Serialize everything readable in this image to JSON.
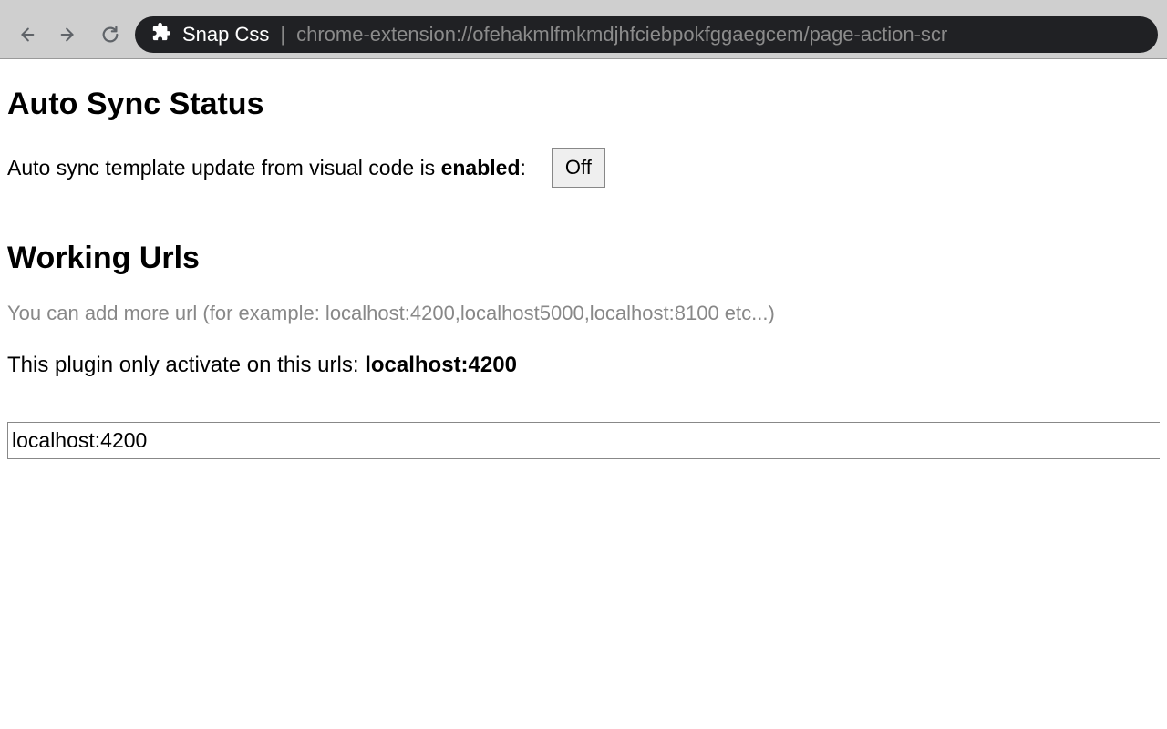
{
  "browser": {
    "extension_name": "Snap Css",
    "url": "chrome-extension://ofehakmlfmkmdjhfciebpokfggaegcem/page-action-scr"
  },
  "page": {
    "section_status": {
      "heading": "Auto Sync Status",
      "label_prefix": "Auto sync template update from visual code is ",
      "status_word": "enabled",
      "label_suffix": ":",
      "toggle_button": "Off"
    },
    "section_urls": {
      "heading": "Working Urls",
      "hint": "You can add more url (for example: localhost:4200,localhost5000,localhost:8100 etc...)",
      "activate_prefix": "This plugin only activate on this urls: ",
      "active_url": "localhost:4200",
      "input_value": "localhost:4200"
    }
  }
}
